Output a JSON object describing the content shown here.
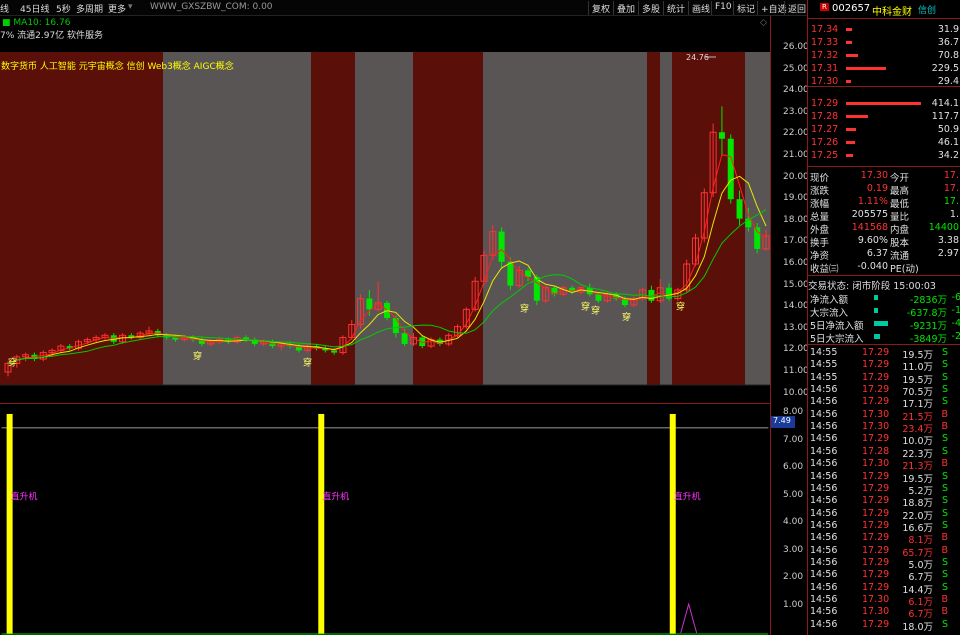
{
  "toolbar": {
    "left_items": [
      "线",
      "45日线",
      "5秒",
      "多周期",
      "更多"
    ],
    "stock_label": "WWW_GXSZBW_COM: 0.00",
    "buttons": [
      "复权",
      "叠加",
      "多股",
      "统计",
      "画线",
      "F10",
      "标记",
      "+自选",
      "返回"
    ]
  },
  "info": {
    "line1_prefix": "MA10: 16.76",
    "line2": "7% 流通2.97亿 软件服务",
    "concepts": "数字货币 人工智能 元宇宙概念 信创 Web3概念 AIGC概念"
  },
  "chart_labels": {
    "peak_label": "24.76",
    "signal_text": "穿",
    "sub_signal_text": "直升机",
    "sub_value": "7.49"
  },
  "price_axis": [
    "26.00",
    "25.00",
    "24.00",
    "23.00",
    "22.00",
    "21.00",
    "20.00",
    "19.00",
    "18.00",
    "17.00",
    "16.00",
    "15.00",
    "14.00",
    "13.00",
    "12.00",
    "11.00",
    "10.00"
  ],
  "sub_axis": [
    "8.00",
    "7.00",
    "6.00",
    "5.00",
    "4.00",
    "3.00",
    "2.00",
    "1.00"
  ],
  "quote": {
    "header_badge": "R",
    "code": "002657",
    "name": "中科金财",
    "tag": "信创",
    "asks": [
      {
        "price": "17.34",
        "vol": "31.9"
      },
      {
        "price": "17.33",
        "vol": "36.7"
      },
      {
        "price": "17.32",
        "vol": "70.8"
      },
      {
        "price": "17.31",
        "vol": "229.5"
      },
      {
        "price": "17.30",
        "vol": "29.4"
      }
    ],
    "bids": [
      {
        "price": "17.29",
        "vol": "414.1"
      },
      {
        "price": "17.28",
        "vol": "117.7"
      },
      {
        "price": "17.27",
        "vol": "50.9"
      },
      {
        "price": "17.26",
        "vol": "46.1"
      },
      {
        "price": "17.25",
        "vol": "34.2"
      }
    ],
    "stats": [
      {
        "l1": "现价",
        "v1": "17.30",
        "l2": "今开",
        "v2": "17.",
        "c1": "red",
        "c2": "red"
      },
      {
        "l1": "涨跌",
        "v1": "0.19",
        "l2": "最高",
        "v2": "17.",
        "c1": "red",
        "c2": "red"
      },
      {
        "l1": "涨幅",
        "v1": "1.11%",
        "l2": "最低",
        "v2": "17.",
        "c1": "red",
        "c2": "green"
      },
      {
        "l1": "总量",
        "v1": "205575",
        "l2": "量比",
        "v2": "1.",
        "c1": "white",
        "c2": "white"
      },
      {
        "l1": "外盘",
        "v1": "141568",
        "l2": "内盘",
        "v2": "14400",
        "c1": "red",
        "c2": "green"
      },
      {
        "l1": "换手",
        "v1": "9.60%",
        "l2": "股本",
        "v2": "3.38",
        "c1": "white",
        "c2": "white"
      },
      {
        "l1": "净资",
        "v1": "6.37",
        "l2": "流通",
        "v2": "2.97",
        "c1": "white",
        "c2": "white"
      },
      {
        "l1": "收益㈢",
        "v1": "-0.040",
        "l2": "PE(动)",
        "v2": "",
        "c1": "white",
        "c2": "white"
      }
    ],
    "trade_status": "交易状态: 闭市阶段 15:00:03",
    "flows": [
      {
        "label": "净流入额",
        "value": "-2836万",
        "tail": "-6"
      },
      {
        "label": "大宗流入",
        "value": "-637.8万",
        "tail": "-1"
      },
      {
        "label": "5日净流入额",
        "value": "-9231万",
        "tail": "-4"
      },
      {
        "label": "5日大宗流入",
        "value": "-3849万",
        "tail": "-2"
      }
    ],
    "ticks": [
      {
        "t": "14:55",
        "p": "17.29",
        "v": "19.5万",
        "s": "S"
      },
      {
        "t": "14:55",
        "p": "17.29",
        "v": "11.0万",
        "s": "S"
      },
      {
        "t": "14:55",
        "p": "17.29",
        "v": "19.5万",
        "s": "S"
      },
      {
        "t": "14:56",
        "p": "17.29",
        "v": "70.5万",
        "s": "S"
      },
      {
        "t": "14:56",
        "p": "17.29",
        "v": "17.1万",
        "s": "S"
      },
      {
        "t": "14:56",
        "p": "17.30",
        "v": "21.5万",
        "s": "B"
      },
      {
        "t": "14:56",
        "p": "17.30",
        "v": "23.4万",
        "s": "B"
      },
      {
        "t": "14:56",
        "p": "17.29",
        "v": "10.0万",
        "s": "S"
      },
      {
        "t": "14:56",
        "p": "17.28",
        "v": "22.3万",
        "s": "S"
      },
      {
        "t": "14:56",
        "p": "17.30",
        "v": "21.3万",
        "s": "B"
      },
      {
        "t": "14:56",
        "p": "17.29",
        "v": "19.5万",
        "s": "S"
      },
      {
        "t": "14:56",
        "p": "17.29",
        "v": "5.2万",
        "s": "S"
      },
      {
        "t": "14:56",
        "p": "17.29",
        "v": "18.8万",
        "s": "S"
      },
      {
        "t": "14:56",
        "p": "17.29",
        "v": "22.0万",
        "s": "S"
      },
      {
        "t": "14:56",
        "p": "17.29",
        "v": "16.6万",
        "s": "S"
      },
      {
        "t": "14:56",
        "p": "17.29",
        "v": "8.1万",
        "s": "B"
      },
      {
        "t": "14:56",
        "p": "17.29",
        "v": "65.7万",
        "s": "B"
      },
      {
        "t": "14:56",
        "p": "17.29",
        "v": "5.0万",
        "s": "S"
      },
      {
        "t": "14:56",
        "p": "17.29",
        "v": "6.7万",
        "s": "S"
      },
      {
        "t": "14:56",
        "p": "17.29",
        "v": "14.4万",
        "s": "S"
      },
      {
        "t": "14:56",
        "p": "17.30",
        "v": "6.1万",
        "s": "B"
      },
      {
        "t": "14:56",
        "p": "17.30",
        "v": "6.7万",
        "s": "B"
      },
      {
        "t": "14:56",
        "p": "17.29",
        "v": "18.0万",
        "s": "S"
      }
    ]
  },
  "colors": {
    "up": "#ff3232",
    "down": "#00e600",
    "band_red": "#5a0f08",
    "band_grey": "#5a5555",
    "ma_red": "#ff2020",
    "ma_yellow": "#ffff00",
    "ma_green": "#00cc00"
  }
}
